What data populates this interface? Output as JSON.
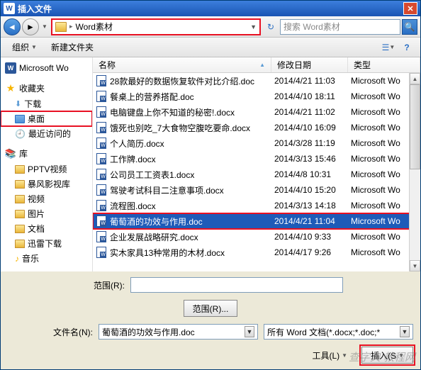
{
  "titlebar": {
    "title": "插入文件"
  },
  "nav": {
    "breadcrumb_text": "Word素材",
    "search_placeholder": "搜索 Word素材"
  },
  "toolbar": {
    "organize": "组织",
    "newfolder": "新建文件夹"
  },
  "sidebar": {
    "word_recent": "Microsoft Wo",
    "favorites": "收藏夹",
    "downloads": "下载",
    "desktop": "桌面",
    "recent": "最近访问的",
    "libraries": "库",
    "pptv": "PPTV视频",
    "baofeng": "暴风影视库",
    "videos": "视频",
    "pictures": "图片",
    "documents": "文档",
    "xunlei": "迅雷下载",
    "music": "音乐"
  },
  "columns": {
    "name": "名称",
    "date": "修改日期",
    "type": "类型"
  },
  "files": [
    {
      "name": "28款最好的数据恢复软件对比介绍.doc",
      "date": "2014/4/21 11:03",
      "type": "Microsoft Wo"
    },
    {
      "name": "餐桌上的营养搭配.doc",
      "date": "2014/4/10 18:11",
      "type": "Microsoft Wo"
    },
    {
      "name": "电脑键盘上你不知道的秘密!.docx",
      "date": "2014/4/21 11:02",
      "type": "Microsoft Wo"
    },
    {
      "name": "饿死也别吃_7大食物空腹吃要命.docx",
      "date": "2014/4/10 16:09",
      "type": "Microsoft Wo"
    },
    {
      "name": "个人简历.docx",
      "date": "2014/3/28 11:19",
      "type": "Microsoft Wo"
    },
    {
      "name": "工作牌.docx",
      "date": "2014/3/13 15:46",
      "type": "Microsoft Wo"
    },
    {
      "name": "公司员工工资表1.docx",
      "date": "2014/4/8 10:31",
      "type": "Microsoft Wo"
    },
    {
      "name": "驾驶考试科目二注意事项.docx",
      "date": "2014/4/10 15:20",
      "type": "Microsoft Wo"
    },
    {
      "name": "流程图.docx",
      "date": "2014/3/13 14:18",
      "type": "Microsoft Wo"
    },
    {
      "name": "葡萄酒的功效与作用.doc",
      "date": "2014/4/21 11:04",
      "type": "Microsoft Wo",
      "selected": true
    },
    {
      "name": "企业发展战略研究.docx",
      "date": "2014/4/10 9:33",
      "type": "Microsoft Wo"
    },
    {
      "name": "实木家具13种常用的木材.docx",
      "date": "2014/4/17 9:26",
      "type": "Microsoft Wo"
    }
  ],
  "bottom": {
    "range_label": "范围(R):",
    "range_btn": "范围(R)...",
    "filename_label": "文件名(N):",
    "filename_value": "葡萄酒的功效与作用.doc",
    "filter_value": "所有 Word 文档(*.docx;*.doc;*",
    "tools_label": "工具(L)",
    "insert_label": "插入(S"
  },
  "watermark": "查字典 教程网"
}
